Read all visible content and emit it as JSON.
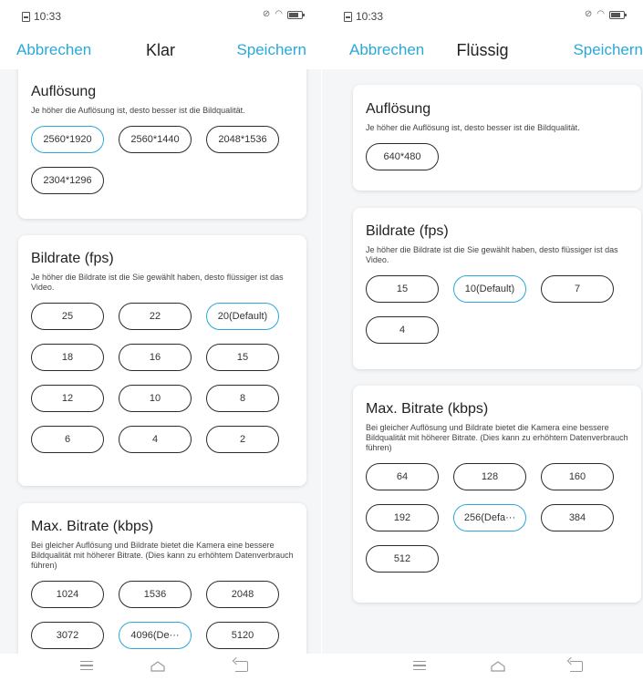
{
  "colors": {
    "accent": "#2aa8d9",
    "background": "#f5f6f8",
    "border": "#2b2b2b"
  },
  "left": {
    "status": {
      "time": "10:33"
    },
    "nav": {
      "cancel": "Abbrechen",
      "title": "Klar",
      "save": "Speichern"
    },
    "resolution": {
      "title": "Auflösung",
      "desc": "Je höher die Auflösung ist, desto besser ist die Bildqualität.",
      "options": [
        "2560*1920",
        "2560*1440",
        "2048*1536",
        "2304*1296"
      ],
      "selected": "2560*1920"
    },
    "framerate": {
      "title": "Bildrate (fps)",
      "desc": "Je höher die Bildrate ist die Sie gewählt haben, desto flüssiger ist das Video.",
      "options": [
        "25",
        "22",
        "20(Default)",
        "18",
        "16",
        "15",
        "12",
        "10",
        "8",
        "6",
        "4",
        "2"
      ],
      "selected": "20(Default)"
    },
    "bitrate": {
      "title": "Max. Bitrate (kbps)",
      "desc": "Bei gleicher Auflösung und Bildrate bietet die Kamera eine bessere Bildqualität mit höherer Bitrate. (Dies kann zu erhöhtem Datenverbrauch führen)",
      "options": [
        "1024",
        "1536",
        "2048",
        "3072",
        "4096(De···",
        "5120"
      ],
      "selected": "4096(De···"
    }
  },
  "right": {
    "status": {
      "time": "10:33"
    },
    "nav": {
      "cancel": "Abbrechen",
      "title": "Flüssig",
      "save": "Speichern"
    },
    "resolution": {
      "title": "Auflösung",
      "desc": "Je höher die Auflösung ist, desto besser ist die Bildqualität.",
      "options": [
        "640*480"
      ],
      "selected": null
    },
    "framerate": {
      "title": "Bildrate (fps)",
      "desc": "Je höher die Bildrate ist die Sie gewählt haben, desto flüssiger ist das Video.",
      "options": [
        "15",
        "10(Default)",
        "7",
        "4"
      ],
      "selected": "10(Default)"
    },
    "bitrate": {
      "title": "Max. Bitrate (kbps)",
      "desc": "Bei gleicher Auflösung und Bildrate bietet die Kamera eine bessere Bildqualität mit höherer Bitrate. (Dies kann zu erhöhtem Datenverbrauch führen)",
      "options": [
        "64",
        "128",
        "160",
        "192",
        "256(Defa···",
        "384",
        "512"
      ],
      "selected": "256(Defa···"
    }
  }
}
